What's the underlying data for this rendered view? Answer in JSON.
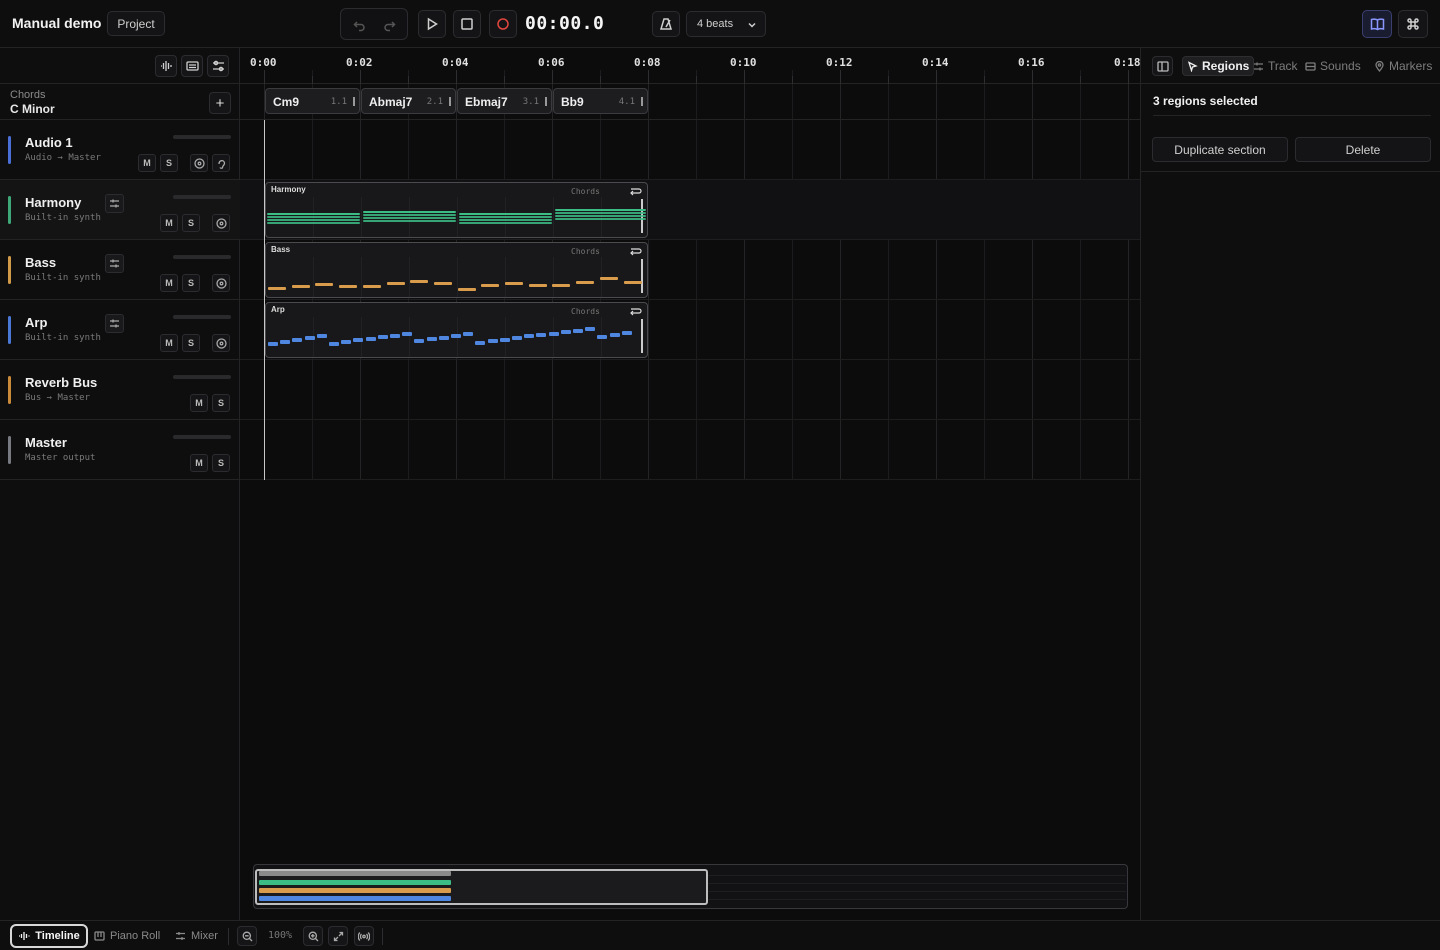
{
  "app": {
    "title": "Manual demo",
    "project_label": "Project",
    "time": "00:00.0",
    "beats_label": "4 beats"
  },
  "chords_header": {
    "label": "Chords",
    "key": "C Minor"
  },
  "tracks": [
    {
      "name": "Audio 1",
      "sub": "Audio → Master",
      "color": "#4a6fd6"
    },
    {
      "name": "Harmony",
      "sub": "Built-in synth",
      "color": "#3ea878"
    },
    {
      "name": "Bass",
      "sub": "Built-in synth",
      "color": "#d09a48"
    },
    {
      "name": "Arp",
      "sub": "Built-in synth",
      "color": "#4a78d6"
    },
    {
      "name": "Reverb Bus",
      "sub": "Bus → Master",
      "color": "#c98a3a"
    },
    {
      "name": "Master",
      "sub": "Master output",
      "color": "#777a80"
    }
  ],
  "track_buttons": {
    "mute": "M",
    "solo": "S"
  },
  "ruler": [
    "0:00",
    "0:02",
    "0:04",
    "0:06",
    "0:08",
    "0:10",
    "0:12",
    "0:14",
    "0:16",
    "0:18"
  ],
  "chords": [
    {
      "name": "Cm9",
      "beat": "1.1"
    },
    {
      "name": "Abmaj7",
      "beat": "2.1"
    },
    {
      "name": "Ebmaj7",
      "beat": "3.1"
    },
    {
      "name": "Bb9",
      "beat": "4.1"
    }
  ],
  "regions": [
    {
      "name": "Harmony",
      "tag": "Chords",
      "color": "#3dbd86"
    },
    {
      "name": "Bass",
      "tag": "Chords",
      "color": "#d89c4c"
    },
    {
      "name": "Arp",
      "tag": "Chords",
      "color": "#4f86e0"
    }
  ],
  "right_panel": {
    "tabs": [
      "Regions",
      "Track",
      "Sounds",
      "Markers"
    ],
    "active_tab": "Regions",
    "title": "3 regions selected",
    "duplicate_label": "Duplicate section",
    "delete_label": "Delete"
  },
  "bottom": {
    "tabs": [
      "Timeline",
      "Piano Roll",
      "Mixer"
    ],
    "active_tab": "Timeline",
    "zoom": "100%"
  },
  "colors": {
    "accent": "#8a97ff",
    "record": "#e0463f",
    "harmony": "#3dbd86",
    "bass": "#d89c4c",
    "arp": "#4f86e0"
  }
}
